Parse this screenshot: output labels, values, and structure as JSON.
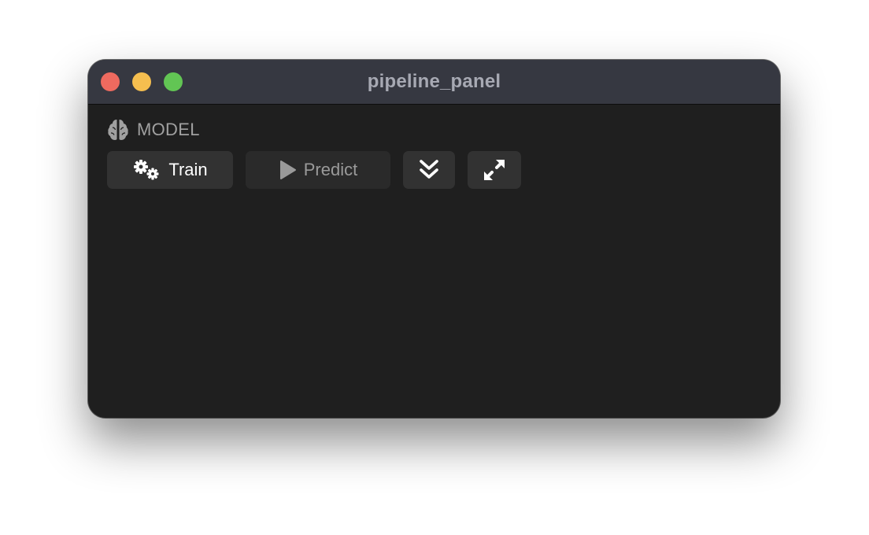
{
  "window": {
    "title": "pipeline_panel",
    "controls": {
      "close_color": "#ee6a5f",
      "minimize_color": "#f5be4f",
      "zoom_color": "#62c554"
    }
  },
  "section": {
    "icon": "brain-icon",
    "label": "MODEL"
  },
  "toolbar": {
    "train": {
      "icon": "gears-icon",
      "label": "Train",
      "enabled": true
    },
    "predict": {
      "icon": "play-icon",
      "label": "Predict",
      "enabled": false
    },
    "collapse": {
      "icon": "double-chevron-down-icon"
    },
    "expand": {
      "icon": "expand-arrows-icon"
    }
  },
  "colors": {
    "window_bg": "#1f1f1f",
    "titlebar_bg": "#363841",
    "button_bg": "#323232",
    "button_disabled_bg": "#2a2a2a",
    "text_primary": "#ffffff",
    "text_muted": "#a0a0a0"
  }
}
